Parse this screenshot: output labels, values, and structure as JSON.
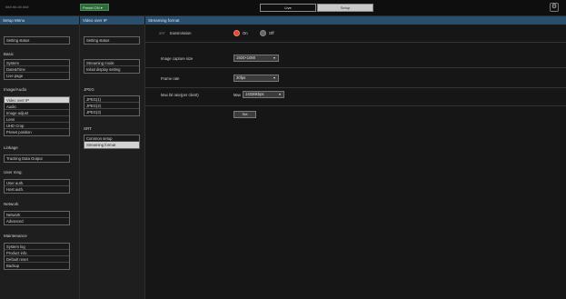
{
  "header": {
    "ip_text": "###.##.##.###",
    "preset_label": "Preset ON",
    "tabs": {
      "live": "Live",
      "setup": "Setup"
    }
  },
  "titles": {
    "menu": "Setup Menu",
    "submenu": "Video over IP",
    "content": "Streaming format"
  },
  "sidebar": {
    "setting_status": "Setting status",
    "basic": {
      "heading": "Basic",
      "items": [
        "System",
        "Date&Time",
        "Live page"
      ]
    },
    "image_audio": {
      "heading": "Image/Audio",
      "items": [
        "Video over IP",
        "Audio",
        "Image adjust",
        "Lens",
        "UHD Crop",
        "Preset position"
      ]
    },
    "linkage": {
      "heading": "Linkage",
      "items": [
        "Tracking Data Output"
      ]
    },
    "user_mng": {
      "heading": "User mng.",
      "items": [
        "User auth.",
        "Host auth."
      ]
    },
    "network": {
      "heading": "Network",
      "items": [
        "Network",
        "Advanced"
      ]
    },
    "maintenance": {
      "heading": "Maintenance",
      "items": [
        "System log",
        "Product info.",
        "Default reset",
        "Backup"
      ]
    }
  },
  "submenu": {
    "setting_status": "Setting status",
    "group1": [
      "Streaming mode",
      "Initial display setting"
    ],
    "jpeg": {
      "heading": "JPEG",
      "items": [
        "JPEG(1)",
        "JPEG(2)",
        "JPEG(3)"
      ]
    },
    "srt": {
      "heading": "SRT",
      "items": [
        "Common setup",
        "Streaming format"
      ]
    }
  },
  "form": {
    "transmission": {
      "tag": "SRT",
      "label": "transmission",
      "on": "On",
      "off": "Off",
      "selected": "On"
    },
    "image_capture_size": {
      "label": "Image capture size",
      "value": "1920×1080"
    },
    "frame_rate": {
      "label": "Frame rate",
      "value": "30fps"
    },
    "max_bit_rate": {
      "label": "Max bit rate(per client)",
      "prefix": "Max",
      "value": "14336kbps"
    },
    "set_button": "Set"
  },
  "colors": {
    "accent_title": "#2a4e6e",
    "radio_on": "#e14a3b",
    "preset_green": "#2e6a3a"
  },
  "icons": {
    "settings": "gear-icon",
    "dropdown": "chevron-down-icon"
  }
}
